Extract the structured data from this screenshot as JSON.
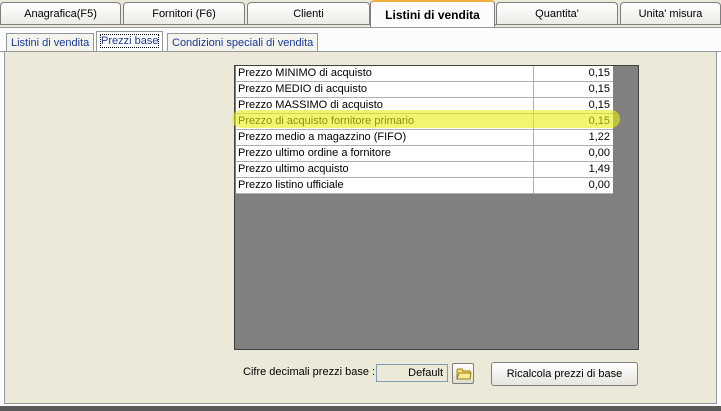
{
  "top_tabs": [
    {
      "label": "Anagrafica(F5)"
    },
    {
      "label": "Fornitori (F6)"
    },
    {
      "label": "Clienti"
    },
    {
      "label": "Listini di vendita"
    },
    {
      "label": "Quantita'"
    },
    {
      "label": "Unita' misura"
    }
  ],
  "sub_tabs": [
    {
      "label": "Listini di vendita"
    },
    {
      "label": "Prezzi base"
    },
    {
      "label": "Condizioni speciali di vendita"
    }
  ],
  "price_rows": [
    {
      "label": "Prezzo MINIMO di acquisto",
      "value": "0,15"
    },
    {
      "label": "Prezzo MEDIO di acquisto",
      "value": "0,15"
    },
    {
      "label": "Prezzo MASSIMO di acquisto",
      "value": "0,15"
    },
    {
      "label": "Prezzo di acquisto fornitore primario",
      "value": "0,15"
    },
    {
      "label": "Prezzo medio a magazzino (FIFO)",
      "value": "1,22"
    },
    {
      "label": "Prezzo ultimo ordine a fornitore",
      "value": "0,00"
    },
    {
      "label": "Prezzo ultimo acquisto",
      "value": "1,49"
    },
    {
      "label": "Prezzo listino ufficiale",
      "value": "0,00"
    }
  ],
  "decimals": {
    "label": "Cifre decimali prezzi base :",
    "value": "Default"
  },
  "recalc_button": "Ricalcola prezzi di base",
  "colors": {
    "highlight": "#e8f014",
    "grid_background": "#808080",
    "tab_accent": "#f0b040"
  }
}
